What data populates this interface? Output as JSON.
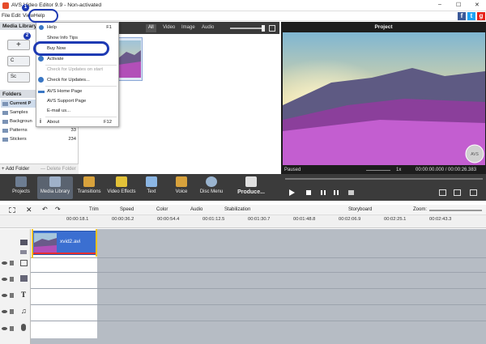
{
  "window": {
    "title": "AVS Video Editor 9.9 - Non-activated",
    "min": "–",
    "max": "☐",
    "close": "✕"
  },
  "menubar": [
    "File",
    "Edit",
    "View",
    "Help"
  ],
  "help_menu": {
    "items": [
      {
        "label": "Help",
        "shortcut": "F1"
      },
      {
        "label": "Show Info Tips",
        "shortcut": ""
      },
      {
        "label": "Buy Now",
        "shortcut": ""
      },
      {
        "label": "Activate",
        "shortcut": ""
      },
      {
        "label": "Check for Updates on start",
        "shortcut": "",
        "disabled": true
      },
      {
        "label": "Check for Updates...",
        "shortcut": ""
      },
      {
        "label": "AVS Home Page",
        "shortcut": ""
      },
      {
        "label": "AVS Support Page",
        "shortcut": ""
      },
      {
        "label": "E-mail us...",
        "shortcut": ""
      },
      {
        "label": "About",
        "shortcut": "F12"
      }
    ]
  },
  "callouts": [
    "1",
    "2"
  ],
  "media_library": {
    "title": "Media Library",
    "buttons": [
      "+",
      "C",
      "Sc"
    ],
    "folders_title": "Folders",
    "folders": [
      {
        "name": "Current P",
        "count": ""
      },
      {
        "name": "Samples",
        "count": ""
      },
      {
        "name": "Backgroun",
        "count": ""
      },
      {
        "name": "Patterns",
        "count": "33"
      },
      {
        "name": "Stickers",
        "count": "234"
      }
    ],
    "add_folder": "+ Add Folder",
    "delete_folder": "— Delete Folder"
  },
  "media_tabs": [
    "All",
    "Video",
    "Image",
    "Audio"
  ],
  "preview": {
    "title": "Project",
    "status": "Paused",
    "speed": "1x",
    "time": "00:00:00.000 / 00:00:26.383",
    "watermark": "AVS"
  },
  "toolbar": [
    "Projects",
    "Media Library",
    "Transitions",
    "Video Effects",
    "Text",
    "Voice",
    "Disc Menu",
    "Produce..."
  ],
  "timeline_tools": [
    "Trim",
    "Speed",
    "Color",
    "Audio",
    "Stabilization",
    "Storyboard",
    "Zoom:"
  ],
  "ruler": [
    "00:00:18.1",
    "00:00:36.2",
    "00:00:54.4",
    "00:01:12.5",
    "00:01:30.7",
    "00:01:48.8",
    "00:02:06.9",
    "00:02:25.1",
    "00:02:43.3"
  ],
  "clip": {
    "name": "xvid2.avi"
  },
  "social": [
    "f",
    "t",
    "g"
  ],
  "colors": {
    "accent": "#1e3ab3",
    "toolbar": "#3b3b3b",
    "clip": "#3b6fd1",
    "playhead": "#f2c21b"
  }
}
